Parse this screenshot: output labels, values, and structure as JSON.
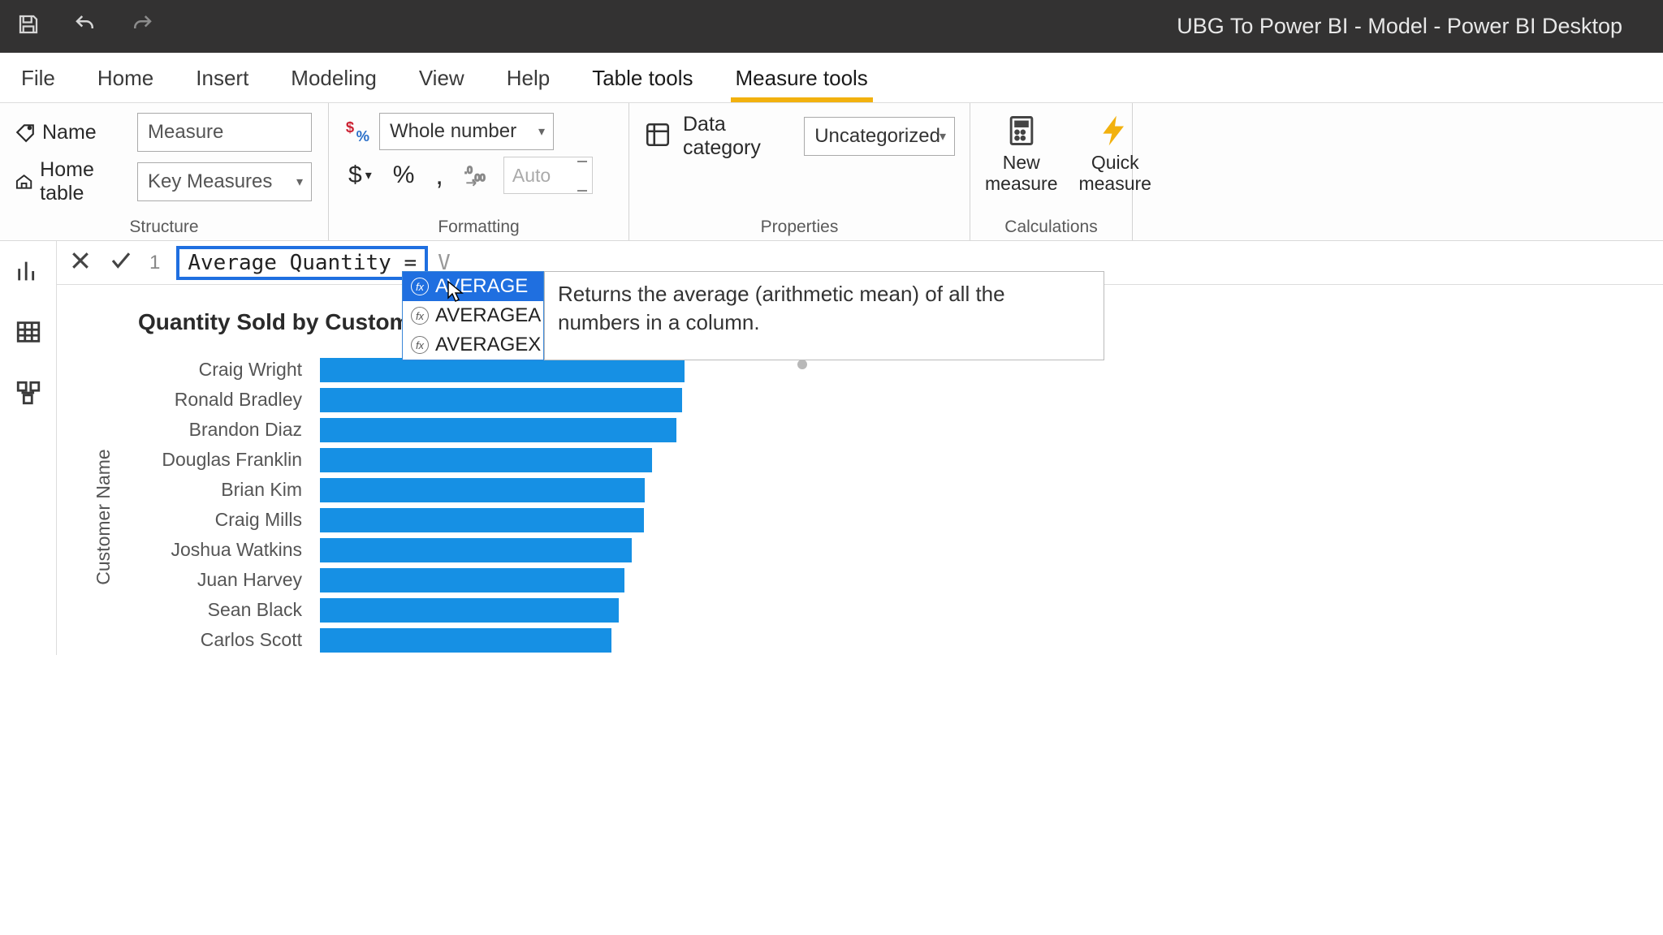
{
  "titlebar": {
    "title": "UBG To Power BI - Model - Power BI Desktop"
  },
  "ribbon_tabs": {
    "file": "File",
    "home": "Home",
    "insert": "Insert",
    "modeling": "Modeling",
    "view": "View",
    "help": "Help",
    "table_tools": "Table tools",
    "measure_tools": "Measure tools"
  },
  "structure": {
    "group_label": "Structure",
    "name_label": "Name",
    "name_value": "Measure",
    "home_table_label": "Home table",
    "home_table_value": "Key Measures"
  },
  "formatting": {
    "group_label": "Formatting",
    "format_value": "Whole number",
    "auto_value": "Auto"
  },
  "properties": {
    "group_label": "Properties",
    "category_label": "Data category",
    "category_value": "Uncategorized"
  },
  "calculations": {
    "group_label": "Calculations",
    "new_measure": "New measure",
    "quick_measure": "Quick measure"
  },
  "formula": {
    "line": "1",
    "text": "Average Quantity =",
    "typed": "V"
  },
  "intellisense": {
    "items": {
      "0": "AVERAGE",
      "1": "AVERAGEA",
      "2": "AVERAGEX"
    },
    "tooltip": "Returns the average (arithmetic mean) of all the numbers in a column."
  },
  "chart_data": {
    "type": "bar",
    "orientation": "horizontal",
    "title": "Quantity Sold by Customer Name",
    "ylabel": "Customer Name",
    "categories": [
      "Craig Wright",
      "Ronald Bradley",
      "Brandon Diaz",
      "Douglas Franklin",
      "Brian Kim",
      "Craig Mills",
      "Joshua Watkins",
      "Juan Harvey",
      "Sean Black",
      "Carlos Scott"
    ],
    "values": [
      390,
      388,
      382,
      356,
      348,
      347,
      334,
      326,
      320,
      312
    ],
    "xlim": [
      0,
      400
    ]
  }
}
